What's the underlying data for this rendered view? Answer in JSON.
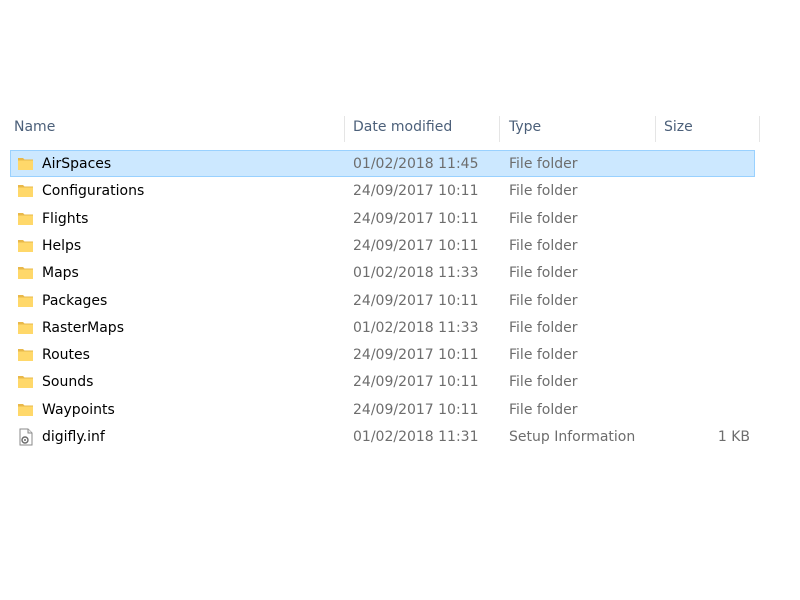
{
  "columns": {
    "name": "Name",
    "date": "Date modified",
    "type": "Type",
    "size": "Size"
  },
  "colors": {
    "selection_bg": "#cce8ff",
    "selection_border": "#99d1ff",
    "folder_yellow": "#ffd86a",
    "header_text": "#4c607a",
    "secondary_text": "#6d6d6d"
  },
  "rows": [
    {
      "name": "AirSpaces",
      "date": "01/02/2018 11:45",
      "type": "File folder",
      "size": "",
      "icon": "folder-icon",
      "selected": true
    },
    {
      "name": "Configurations",
      "date": "24/09/2017 10:11",
      "type": "File folder",
      "size": "",
      "icon": "folder-icon",
      "selected": false
    },
    {
      "name": "Flights",
      "date": "24/09/2017 10:11",
      "type": "File folder",
      "size": "",
      "icon": "folder-icon",
      "selected": false
    },
    {
      "name": "Helps",
      "date": "24/09/2017 10:11",
      "type": "File folder",
      "size": "",
      "icon": "folder-icon",
      "selected": false
    },
    {
      "name": "Maps",
      "date": "01/02/2018 11:33",
      "type": "File folder",
      "size": "",
      "icon": "folder-icon",
      "selected": false
    },
    {
      "name": "Packages",
      "date": "24/09/2017 10:11",
      "type": "File folder",
      "size": "",
      "icon": "folder-icon",
      "selected": false
    },
    {
      "name": "RasterMaps",
      "date": "01/02/2018 11:33",
      "type": "File folder",
      "size": "",
      "icon": "folder-icon",
      "selected": false
    },
    {
      "name": "Routes",
      "date": "24/09/2017 10:11",
      "type": "File folder",
      "size": "",
      "icon": "folder-icon",
      "selected": false
    },
    {
      "name": "Sounds",
      "date": "24/09/2017 10:11",
      "type": "File folder",
      "size": "",
      "icon": "folder-icon",
      "selected": false
    },
    {
      "name": "Waypoints",
      "date": "24/09/2017 10:11",
      "type": "File folder",
      "size": "",
      "icon": "folder-icon",
      "selected": false
    },
    {
      "name": "digifly.inf",
      "date": "01/02/2018 11:31",
      "type": "Setup Information",
      "size": "1 KB",
      "icon": "setup-file-icon",
      "selected": false
    }
  ]
}
